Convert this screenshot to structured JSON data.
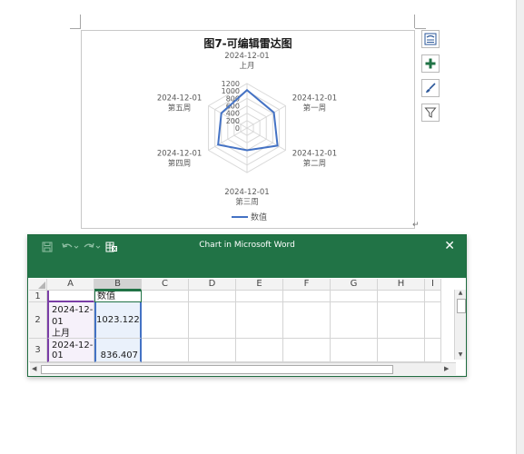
{
  "chart": {
    "title": "图7-可编辑雷达图",
    "legend_label": "数值",
    "axis_ticks": [
      "1200",
      "1000",
      "800",
      "600",
      "400",
      "200",
      "0"
    ],
    "spoke_labels": [
      {
        "date": "2024-12-01",
        "name": "上月"
      },
      {
        "date": "2024-12-01",
        "name": "第一周"
      },
      {
        "date": "2024-12-01",
        "name": "第二周"
      },
      {
        "date": "2024-12-01",
        "name": "第三周"
      },
      {
        "date": "2024-12-01",
        "name": "第四周"
      },
      {
        "date": "2024-12-01",
        "name": "第五周"
      }
    ]
  },
  "chart_data": {
    "type": "radar",
    "title": "图7-可编辑雷达图",
    "categories": [
      "2024-12-01 上月",
      "2024-12-01 第一周",
      "2024-12-01 第二周",
      "2024-12-01 第三周",
      "2024-12-01 第四周",
      "2024-12-01 第五周"
    ],
    "series": [
      {
        "name": "数值",
        "values": [
          1023.122,
          836.407,
          950,
          600,
          900,
          800
        ],
        "color": "#4472c4"
      }
    ],
    "rlim": [
      0,
      1200
    ],
    "ticks": [
      0,
      200,
      400,
      600,
      800,
      1000,
      1200
    ],
    "grid": true,
    "legend": "bottom"
  },
  "side_buttons": {
    "layout_options": "layout-options-icon",
    "chart_elements": "plus-icon",
    "chart_styles": "brush-icon",
    "chart_filters": "filter-icon"
  },
  "excel": {
    "title": "Chart in Microsoft Word",
    "columns": [
      "A",
      "B",
      "C",
      "D",
      "E",
      "F",
      "G",
      "H",
      "I"
    ],
    "rows": [
      {
        "num": "1",
        "a": "",
        "b": "数值"
      },
      {
        "num": "2",
        "a": "2024-12-01\n上月",
        "b": "1023.122"
      },
      {
        "num": "3",
        "a": "2024-12-01",
        "b": "836.407"
      }
    ],
    "close": "✕"
  },
  "colors": {
    "excel_green": "#217346",
    "series_blue": "#4472c4"
  }
}
